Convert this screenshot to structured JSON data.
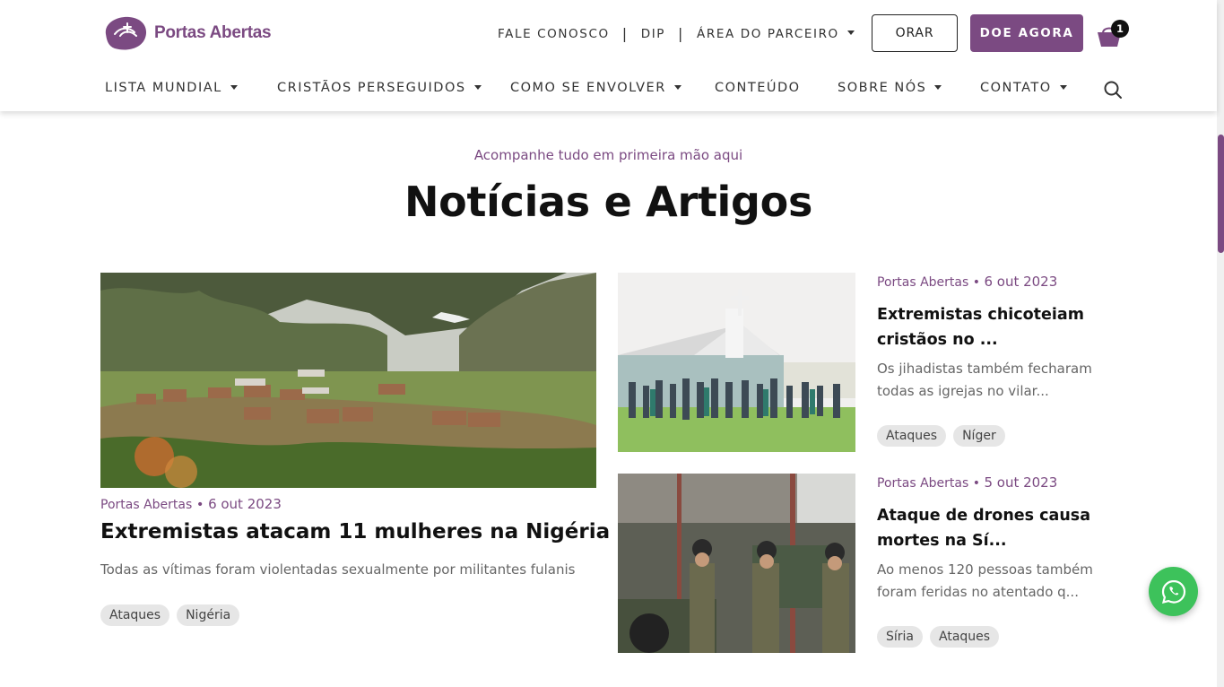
{
  "brand": {
    "name": "Portas Abertas",
    "color": "#7b4a82"
  },
  "topnav": {
    "items": [
      "FALE CONOSCO",
      "DIP",
      "ÁREA DO PARCEIRO"
    ],
    "orar_label": "ORAR",
    "donate_label": "DOE AGORA",
    "cart_count": "1"
  },
  "mainnav": {
    "items": [
      "LISTA MUNDIAL",
      "CRISTÃOS PERSEGUIDOS",
      "COMO SE ENVOLVER",
      "CONTEÚDO",
      "SOBRE NÓS",
      "CONTATO"
    ]
  },
  "section": {
    "kicker": "Acompanhe tudo em primeira mão aqui",
    "title": "Notícias e Artigos"
  },
  "featured": {
    "source": "Portas Abertas",
    "date": "6 out 2023",
    "title": "Extremistas atacam 11 mulheres na Nigéria",
    "description": "Todas as vítimas foram violentadas sexualmente por militantes fulanis",
    "tags": [
      "Ataques",
      "Nigéria"
    ]
  },
  "articles": [
    {
      "source": "Portas Abertas",
      "date": "6 out 2023",
      "title": "Extremistas chicoteiam cristãos no ...",
      "description": "Os jihadistas também fecharam todas as igrejas no vilar...",
      "tags": [
        "Ataques",
        "Níger"
      ]
    },
    {
      "source": "Portas Abertas",
      "date": "5 out 2023",
      "title": "Ataque de drones causa mortes na Sí...",
      "description": "Ao menos 120 pessoas também foram feridas no atentado q...",
      "tags": [
        "Síria",
        "Ataques"
      ]
    }
  ],
  "icons": {
    "cart": "shopping-basket-icon",
    "search": "search-icon",
    "whatsapp": "whatsapp-icon",
    "external": "arrow-up-right-icon"
  }
}
